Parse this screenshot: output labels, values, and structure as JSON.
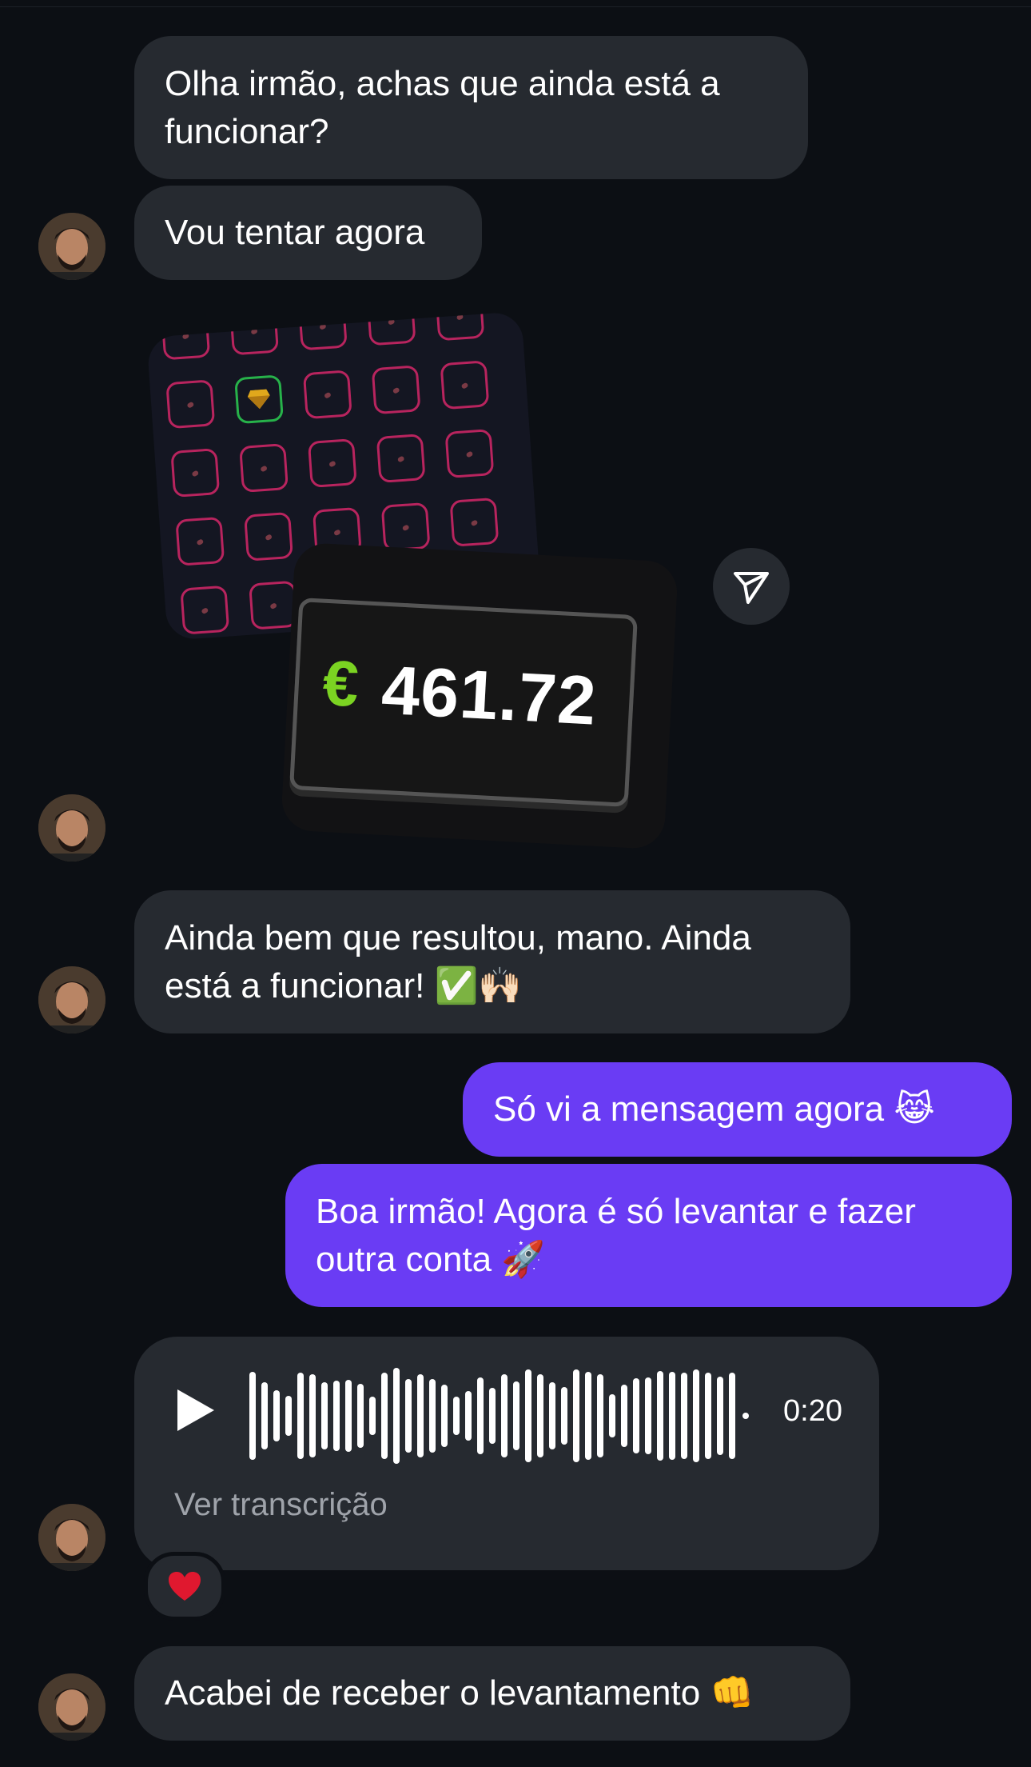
{
  "messages": {
    "m1": {
      "text_line1": "Olha irmão, achas que ainda está a",
      "text_line2": "funcionar?"
    },
    "m2": {
      "text": "Vou tentar agora"
    },
    "game": {
      "euro_symbol": "€",
      "balance": "461.72"
    },
    "m3": {
      "text_line1": "Ainda bem que resultou, mano. Ainda",
      "text_line2": "está a funcionar!",
      "emoji": "✅🙌🏻"
    },
    "m4": {
      "text": "Só vi a mensagem agora",
      "emoji": "😹"
    },
    "m5": {
      "text_line1": "Boa irmão! Agora é só levantar e fazer",
      "text_line2": "outra conta",
      "emoji": "🚀"
    },
    "audio": {
      "duration": "0:20",
      "transcript_label": "Ver transcrição",
      "reaction": "❤️"
    },
    "m6": {
      "text": "Acabei de receber o levantamento",
      "emoji": "👊"
    }
  },
  "colors": {
    "background": "#0c0f14",
    "incoming_bubble": "#262a30",
    "outgoing_bubble": "#6a3cf4",
    "euro_green": "#7bd322"
  },
  "icons": [
    "avatar",
    "send-icon",
    "play-icon",
    "heart-icon",
    "gem-icon"
  ]
}
